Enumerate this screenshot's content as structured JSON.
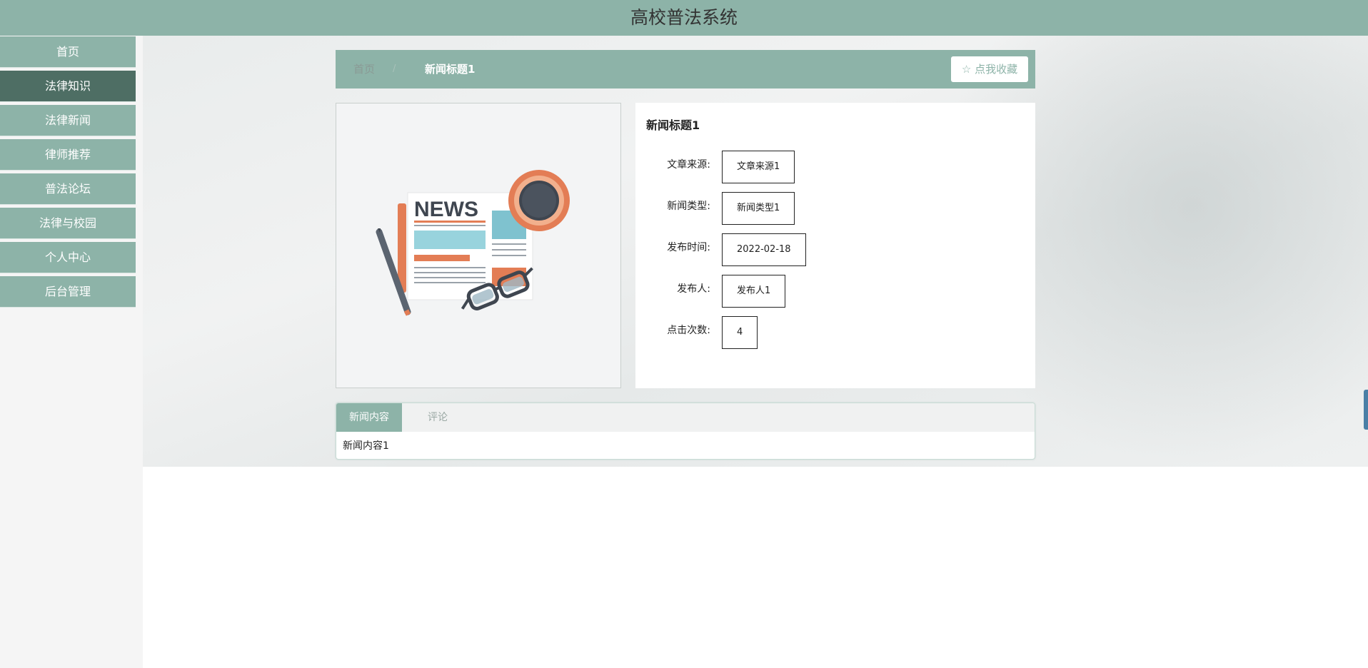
{
  "app": {
    "title": "高校普法系统"
  },
  "sidebar": {
    "items": [
      {
        "label": "首页"
      },
      {
        "label": "法律知识"
      },
      {
        "label": "法律新闻"
      },
      {
        "label": "律师推荐"
      },
      {
        "label": "普法论坛"
      },
      {
        "label": "法律与校园"
      },
      {
        "label": "个人中心"
      },
      {
        "label": "后台管理"
      }
    ],
    "active_index": 1
  },
  "breadcrumb": {
    "home": "首页",
    "separator": "/",
    "current": "新闻标题1"
  },
  "favorite_button": {
    "label": "☆ 点我收藏"
  },
  "image": {
    "text": "NEWS"
  },
  "detail": {
    "title": "新闻标题1",
    "fields": [
      {
        "label": "文章来源:",
        "value": "文章来源1"
      },
      {
        "label": "新闻类型:",
        "value": "新闻类型1"
      },
      {
        "label": "发布时间:",
        "value": "2022-02-18"
      },
      {
        "label": "发布人:",
        "value": "发布人1"
      },
      {
        "label": "点击次数:",
        "value": "4"
      }
    ]
  },
  "tabs": {
    "items": [
      {
        "label": "新闻内容"
      },
      {
        "label": "评论"
      }
    ],
    "active_index": 0,
    "content": "新闻内容1"
  },
  "colors": {
    "primary": "#8db3a8",
    "active_nav": "#4e6e64",
    "scroll_handle": "#4a7fa6"
  }
}
